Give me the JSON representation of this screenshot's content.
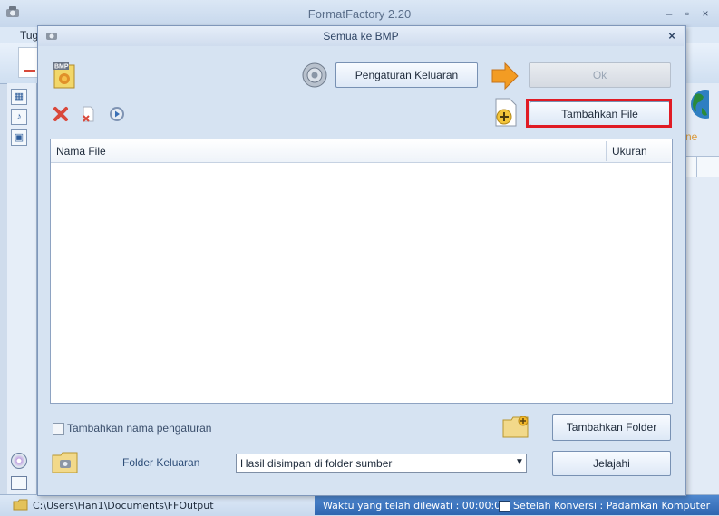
{
  "app": {
    "title": "FormatFactory 2.20",
    "menu_first": "Tug",
    "window_buttons": [
      "–",
      "▫",
      "×"
    ]
  },
  "dialog": {
    "title": "Semua ke BMP",
    "close": "×",
    "output_settings_label": "Pengaturan Keluaran",
    "ok_label": "Ok",
    "ok_enabled": false,
    "add_file_label": "Tambahkan File",
    "table": {
      "columns": [
        "Nama File",
        "Ukuran"
      ],
      "rows": []
    },
    "add_setting_name_label": "Tambahkan nama pengaturan",
    "add_setting_name_checked": false,
    "add_folder_label": "Tambahkan Folder",
    "output_folder_label": "Folder Keluaran",
    "output_folder_selected": "Hasil disimpan di folder sumber",
    "browse_label": "Jelajahi",
    "format_badge": "BMP"
  },
  "right_panel": {
    "partial_text": "ne"
  },
  "status": {
    "path": "C:\\Users\\Han1\\Documents\\FFOutput",
    "elapsed": "Waktu yang telah dilewati : 00:00:00",
    "after_conversion": "Setelah Konversi : Padamkan Komputer",
    "after_conversion_checked": false
  },
  "colors": {
    "highlight": "#e01b24",
    "status_bar": "#3a74c0",
    "dialog_bg": "#d6e3f2"
  }
}
